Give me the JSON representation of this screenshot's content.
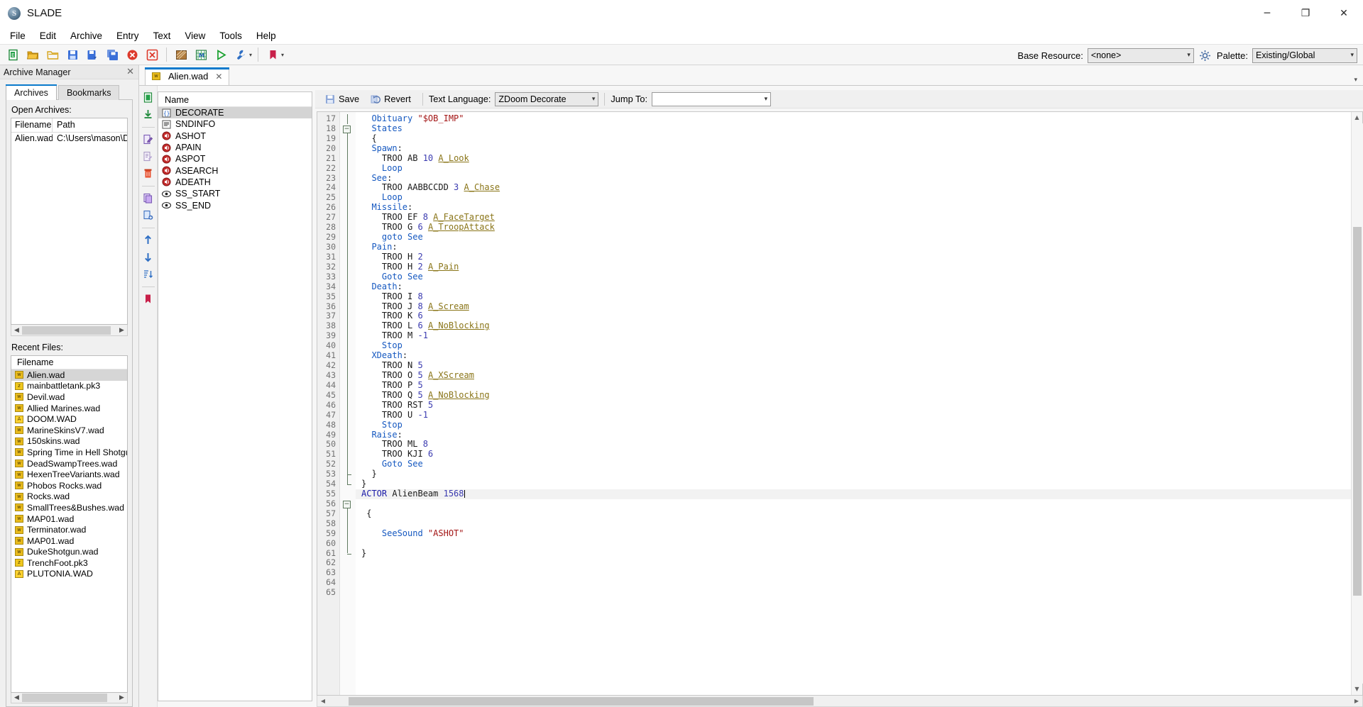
{
  "window": {
    "title": "SLADE",
    "app_icon": "slade-logo-icon",
    "minimize": "─",
    "maximize": "❐",
    "close": "✕"
  },
  "menubar": {
    "items": [
      "File",
      "Edit",
      "Archive",
      "Entry",
      "Text",
      "View",
      "Tools",
      "Help"
    ]
  },
  "toolbar": {
    "buttons": [
      {
        "name": "new-archive-icon",
        "tip": "New Archive"
      },
      {
        "name": "open-archive-icon",
        "tip": "Open Archive"
      },
      {
        "name": "open-folder-icon",
        "tip": "Open Directory"
      },
      {
        "name": "save-archive-icon",
        "tip": "Save"
      },
      {
        "name": "save-as-icon",
        "tip": "Save As"
      },
      {
        "name": "save-all-icon",
        "tip": "Save All"
      },
      {
        "name": "close-archive-icon",
        "tip": "Close"
      },
      {
        "name": "close-all-icon",
        "tip": "Close All"
      },
      {
        "name": "texture-editor-icon",
        "tip": "Texture Editor"
      },
      {
        "name": "map-editor-icon",
        "tip": "Map Editor"
      },
      {
        "name": "run-icon",
        "tip": "Run"
      },
      {
        "name": "maintenance-icon",
        "tip": "Maintenance"
      },
      {
        "name": "bookmark-icon",
        "tip": "Bookmarks"
      }
    ],
    "base_resource_label": "Base Resource:",
    "base_resource_value": "<none>",
    "settings_icon": "gear-icon",
    "palette_label": "Palette:",
    "palette_value": "Existing/Global"
  },
  "archive_manager": {
    "title": "Archive Manager",
    "close_icon": "close-icon",
    "tabs": [
      {
        "label": "Archives",
        "active": true
      },
      {
        "label": "Bookmarks",
        "active": false
      }
    ],
    "open_archives_label": "Open Archives:",
    "columns": [
      "Filename",
      "Path"
    ],
    "rows": [
      {
        "filename": "Alien.wad",
        "path": "C:\\Users\\mason\\Desktop"
      }
    ],
    "recent_files_label": "Recent Files:",
    "recent_column": "Filename",
    "recent_files": [
      {
        "name": "Alien.wad",
        "type": "wad",
        "selected": true
      },
      {
        "name": "mainbattletank.pk3",
        "type": "pk3",
        "selected": false
      },
      {
        "name": "Devil.wad",
        "type": "wad",
        "selected": false
      },
      {
        "name": "Allied Marines.wad",
        "type": "wad",
        "selected": false
      },
      {
        "name": "DOOM.WAD",
        "type": "iwad",
        "selected": false
      },
      {
        "name": "MarineSkinsV7.wad",
        "type": "wad",
        "selected": false
      },
      {
        "name": "150skins.wad",
        "type": "wad",
        "selected": false
      },
      {
        "name": "Spring Time in Hell Shotgun.wa",
        "type": "wad",
        "selected": false
      },
      {
        "name": "DeadSwampTrees.wad",
        "type": "wad",
        "selected": false
      },
      {
        "name": "HexenTreeVariants.wad",
        "type": "wad",
        "selected": false
      },
      {
        "name": "Phobos Rocks.wad",
        "type": "wad",
        "selected": false
      },
      {
        "name": "Rocks.wad",
        "type": "wad",
        "selected": false
      },
      {
        "name": "SmallTrees&Bushes.wad",
        "type": "wad",
        "selected": false
      },
      {
        "name": "MAP01.wad",
        "type": "wad",
        "selected": false
      },
      {
        "name": "Terminator.wad",
        "type": "wad",
        "selected": false
      },
      {
        "name": "MAP01.wad",
        "type": "wad",
        "selected": false
      },
      {
        "name": "DukeShotgun.wad",
        "type": "wad",
        "selected": false
      },
      {
        "name": "TrenchFoot.pk3",
        "type": "pk3",
        "selected": false
      },
      {
        "name": "PLUTONIA.WAD",
        "type": "iwad",
        "selected": false
      }
    ]
  },
  "archive_tab": {
    "label": "Alien.wad",
    "icon": "wad-file-icon",
    "close_icon": "close-icon",
    "collapse_icon": "chevron-down-icon"
  },
  "entry_toolbar": {
    "buttons": [
      {
        "name": "new-entry-icon"
      },
      {
        "name": "import-entry-icon"
      },
      {
        "name": "rename-entry-icon"
      },
      {
        "name": "edit-entry-icon"
      },
      {
        "name": "delete-entry-icon"
      },
      {
        "name": "copy-entry-icon"
      },
      {
        "name": "paste-entry-icon"
      },
      {
        "name": "move-up-icon"
      },
      {
        "name": "move-down-icon"
      },
      {
        "name": "sort-icon"
      },
      {
        "name": "bookmark-icon"
      },
      {
        "name": "filter-icon"
      }
    ]
  },
  "entry_list": {
    "column": "Name",
    "entries": [
      {
        "name": "DECORATE",
        "icon": "text-braces-icon",
        "selected": true
      },
      {
        "name": "SNDINFO",
        "icon": "text-lines-icon",
        "selected": false
      },
      {
        "name": "ASHOT",
        "icon": "sound-icon",
        "selected": false
      },
      {
        "name": "APAIN",
        "icon": "sound-icon",
        "selected": false
      },
      {
        "name": "ASPOT",
        "icon": "sound-icon",
        "selected": false
      },
      {
        "name": "ASEARCH",
        "icon": "sound-icon",
        "selected": false
      },
      {
        "name": "ADEATH",
        "icon": "sound-icon",
        "selected": false
      },
      {
        "name": "SS_START",
        "icon": "marker-eye-icon",
        "selected": false
      },
      {
        "name": "SS_END",
        "icon": "marker-eye-icon",
        "selected": false
      }
    ]
  },
  "editor_toolbar": {
    "save_label": "Save",
    "save_icon": "save-icon",
    "revert_label": "Revert",
    "revert_icon": "revert-icon",
    "language_label": "Text Language:",
    "language_value": "ZDoom Decorate",
    "jump_label": "Jump To:",
    "jump_value": ""
  },
  "code": {
    "first_line": 17,
    "cursor_line": 55,
    "lines": [
      {
        "n": 17,
        "fold": "bar",
        "tokens": [
          {
            "t": "  ",
            "c": "pl"
          },
          {
            "t": "Obituary ",
            "c": "k"
          },
          {
            "t": "\"$OB_IMP\"",
            "c": "str"
          }
        ]
      },
      {
        "n": 18,
        "fold": "boxtop",
        "tokens": [
          {
            "t": "  ",
            "c": "pl"
          },
          {
            "t": "States",
            "c": "k"
          }
        ]
      },
      {
        "n": 19,
        "fold": "bar",
        "tokens": [
          {
            "t": "  {",
            "c": "pl"
          }
        ]
      },
      {
        "n": 20,
        "fold": "bar",
        "tokens": [
          {
            "t": "  ",
            "c": "pl"
          },
          {
            "t": "Spawn",
            "c": "k"
          },
          {
            "t": ":",
            "c": "pl"
          }
        ]
      },
      {
        "n": 21,
        "fold": "bar",
        "tokens": [
          {
            "t": "    TROO AB ",
            "c": "pl"
          },
          {
            "t": "10",
            "c": "num"
          },
          {
            "t": " ",
            "c": "pl"
          },
          {
            "t": "A_Look",
            "c": "fn"
          }
        ]
      },
      {
        "n": 22,
        "fold": "bar",
        "tokens": [
          {
            "t": "    ",
            "c": "pl"
          },
          {
            "t": "Loop",
            "c": "k"
          }
        ]
      },
      {
        "n": 23,
        "fold": "bar",
        "tokens": [
          {
            "t": "  ",
            "c": "pl"
          },
          {
            "t": "See",
            "c": "k"
          },
          {
            "t": ":",
            "c": "pl"
          }
        ]
      },
      {
        "n": 24,
        "fold": "bar",
        "tokens": [
          {
            "t": "    TROO AABBCCDD ",
            "c": "pl"
          },
          {
            "t": "3",
            "c": "num"
          },
          {
            "t": " ",
            "c": "pl"
          },
          {
            "t": "A_Chase",
            "c": "fn"
          }
        ]
      },
      {
        "n": 25,
        "fold": "bar",
        "tokens": [
          {
            "t": "    ",
            "c": "pl"
          },
          {
            "t": "Loop",
            "c": "k"
          }
        ]
      },
      {
        "n": 26,
        "fold": "bar",
        "tokens": [
          {
            "t": "  ",
            "c": "pl"
          },
          {
            "t": "Missile",
            "c": "k"
          },
          {
            "t": ":",
            "c": "pl"
          }
        ]
      },
      {
        "n": 27,
        "fold": "bar",
        "tokens": [
          {
            "t": "    TROO EF ",
            "c": "pl"
          },
          {
            "t": "8",
            "c": "num"
          },
          {
            "t": " ",
            "c": "pl"
          },
          {
            "t": "A_FaceTarget",
            "c": "fn"
          }
        ]
      },
      {
        "n": 28,
        "fold": "bar",
        "tokens": [
          {
            "t": "    TROO G ",
            "c": "pl"
          },
          {
            "t": "6",
            "c": "num"
          },
          {
            "t": " ",
            "c": "pl"
          },
          {
            "t": "A_TroopAttack",
            "c": "fn"
          }
        ]
      },
      {
        "n": 29,
        "fold": "bar",
        "tokens": [
          {
            "t": "    ",
            "c": "pl"
          },
          {
            "t": "goto See",
            "c": "k"
          }
        ]
      },
      {
        "n": 30,
        "fold": "bar",
        "tokens": [
          {
            "t": "  ",
            "c": "pl"
          },
          {
            "t": "Pain",
            "c": "k"
          },
          {
            "t": ":",
            "c": "pl"
          }
        ]
      },
      {
        "n": 31,
        "fold": "bar",
        "tokens": [
          {
            "t": "    TROO H ",
            "c": "pl"
          },
          {
            "t": "2",
            "c": "num"
          }
        ]
      },
      {
        "n": 32,
        "fold": "bar",
        "tokens": [
          {
            "t": "    TROO H ",
            "c": "pl"
          },
          {
            "t": "2",
            "c": "num"
          },
          {
            "t": " ",
            "c": "pl"
          },
          {
            "t": "A_Pain",
            "c": "fn"
          }
        ]
      },
      {
        "n": 33,
        "fold": "bar",
        "tokens": [
          {
            "t": "    ",
            "c": "pl"
          },
          {
            "t": "Goto See",
            "c": "k"
          }
        ]
      },
      {
        "n": 34,
        "fold": "bar",
        "tokens": [
          {
            "t": "  ",
            "c": "pl"
          },
          {
            "t": "Death",
            "c": "k"
          },
          {
            "t": ":",
            "c": "pl"
          }
        ]
      },
      {
        "n": 35,
        "fold": "bar",
        "tokens": [
          {
            "t": "    TROO I ",
            "c": "pl"
          },
          {
            "t": "8",
            "c": "num"
          }
        ]
      },
      {
        "n": 36,
        "fold": "bar",
        "tokens": [
          {
            "t": "    TROO J ",
            "c": "pl"
          },
          {
            "t": "8",
            "c": "num"
          },
          {
            "t": " ",
            "c": "pl"
          },
          {
            "t": "A_Scream",
            "c": "fn"
          }
        ]
      },
      {
        "n": 37,
        "fold": "bar",
        "tokens": [
          {
            "t": "    TROO K ",
            "c": "pl"
          },
          {
            "t": "6",
            "c": "num"
          }
        ]
      },
      {
        "n": 38,
        "fold": "bar",
        "tokens": [
          {
            "t": "    TROO L ",
            "c": "pl"
          },
          {
            "t": "6",
            "c": "num"
          },
          {
            "t": " ",
            "c": "pl"
          },
          {
            "t": "A_NoBlocking",
            "c": "fn"
          }
        ]
      },
      {
        "n": 39,
        "fold": "bar",
        "tokens": [
          {
            "t": "    TROO M ",
            "c": "pl"
          },
          {
            "t": "-1",
            "c": "num"
          }
        ]
      },
      {
        "n": 40,
        "fold": "bar",
        "tokens": [
          {
            "t": "    ",
            "c": "pl"
          },
          {
            "t": "Stop",
            "c": "k"
          }
        ]
      },
      {
        "n": 41,
        "fold": "bar",
        "tokens": [
          {
            "t": "  ",
            "c": "pl"
          },
          {
            "t": "XDeath",
            "c": "k"
          },
          {
            "t": ":",
            "c": "pl"
          }
        ]
      },
      {
        "n": 42,
        "fold": "bar",
        "tokens": [
          {
            "t": "    TROO N ",
            "c": "pl"
          },
          {
            "t": "5",
            "c": "num"
          }
        ]
      },
      {
        "n": 43,
        "fold": "bar",
        "tokens": [
          {
            "t": "    TROO O ",
            "c": "pl"
          },
          {
            "t": "5",
            "c": "num"
          },
          {
            "t": " ",
            "c": "pl"
          },
          {
            "t": "A_XScream",
            "c": "fn"
          }
        ]
      },
      {
        "n": 44,
        "fold": "bar",
        "tokens": [
          {
            "t": "    TROO P ",
            "c": "pl"
          },
          {
            "t": "5",
            "c": "num"
          }
        ]
      },
      {
        "n": 45,
        "fold": "bar",
        "tokens": [
          {
            "t": "    TROO Q ",
            "c": "pl"
          },
          {
            "t": "5",
            "c": "num"
          },
          {
            "t": " ",
            "c": "pl"
          },
          {
            "t": "A_NoBlocking",
            "c": "fn"
          }
        ]
      },
      {
        "n": 46,
        "fold": "bar",
        "tokens": [
          {
            "t": "    TROO RST ",
            "c": "pl"
          },
          {
            "t": "5",
            "c": "num"
          }
        ]
      },
      {
        "n": 47,
        "fold": "bar",
        "tokens": [
          {
            "t": "    TROO U ",
            "c": "pl"
          },
          {
            "t": "-1",
            "c": "num"
          }
        ]
      },
      {
        "n": 48,
        "fold": "bar",
        "tokens": [
          {
            "t": "    ",
            "c": "pl"
          },
          {
            "t": "Stop",
            "c": "k"
          }
        ]
      },
      {
        "n": 49,
        "fold": "bar",
        "tokens": [
          {
            "t": "  ",
            "c": "pl"
          },
          {
            "t": "Raise",
            "c": "k"
          },
          {
            "t": ":",
            "c": "pl"
          }
        ]
      },
      {
        "n": 50,
        "fold": "bar",
        "tokens": [
          {
            "t": "    TROO ML ",
            "c": "pl"
          },
          {
            "t": "8",
            "c": "num"
          }
        ]
      },
      {
        "n": 51,
        "fold": "bar",
        "tokens": [
          {
            "t": "    TROO KJI ",
            "c": "pl"
          },
          {
            "t": "6",
            "c": "num"
          }
        ]
      },
      {
        "n": 52,
        "fold": "bar",
        "tokens": [
          {
            "t": "    ",
            "c": "pl"
          },
          {
            "t": "Goto See",
            "c": "k"
          }
        ]
      },
      {
        "n": 53,
        "fold": "endmid",
        "tokens": [
          {
            "t": "  }",
            "c": "pl"
          }
        ]
      },
      {
        "n": 54,
        "fold": "endbot",
        "tokens": [
          {
            "t": "}",
            "c": "pl"
          }
        ]
      },
      {
        "n": 55,
        "fold": "none",
        "cursor": true,
        "tokens": [
          {
            "t": "ACTOR",
            "c": "kb"
          },
          {
            "t": " AlienBeam ",
            "c": "pl"
          },
          {
            "t": "1568",
            "c": "num"
          }
        ]
      },
      {
        "n": 56,
        "fold": "boxtop",
        "tokens": []
      },
      {
        "n": 57,
        "fold": "bar",
        "tokens": [
          {
            "t": " {",
            "c": "pl"
          }
        ]
      },
      {
        "n": 58,
        "fold": "bar",
        "tokens": []
      },
      {
        "n": 59,
        "fold": "bar",
        "tokens": [
          {
            "t": "    ",
            "c": "pl"
          },
          {
            "t": "SeeSound",
            "c": "k"
          },
          {
            "t": " ",
            "c": "pl"
          },
          {
            "t": "\"ASHOT\"",
            "c": "str"
          }
        ]
      },
      {
        "n": 60,
        "fold": "bar",
        "tokens": []
      },
      {
        "n": 61,
        "fold": "endbot",
        "tokens": [
          {
            "t": "}",
            "c": "pl"
          }
        ]
      },
      {
        "n": 62,
        "fold": "none",
        "tokens": []
      },
      {
        "n": 63,
        "fold": "none",
        "tokens": []
      },
      {
        "n": 64,
        "fold": "none",
        "tokens": []
      },
      {
        "n": 65,
        "fold": "none",
        "tokens": []
      }
    ]
  },
  "colors": {
    "accent": "#0a7acc",
    "keyword": "#1558c0",
    "string": "#a31515",
    "number": "#3b3bb0",
    "action": "#8a7518",
    "selection": "#d4d4d4",
    "toolbar_bg": "#f6f6f6"
  }
}
